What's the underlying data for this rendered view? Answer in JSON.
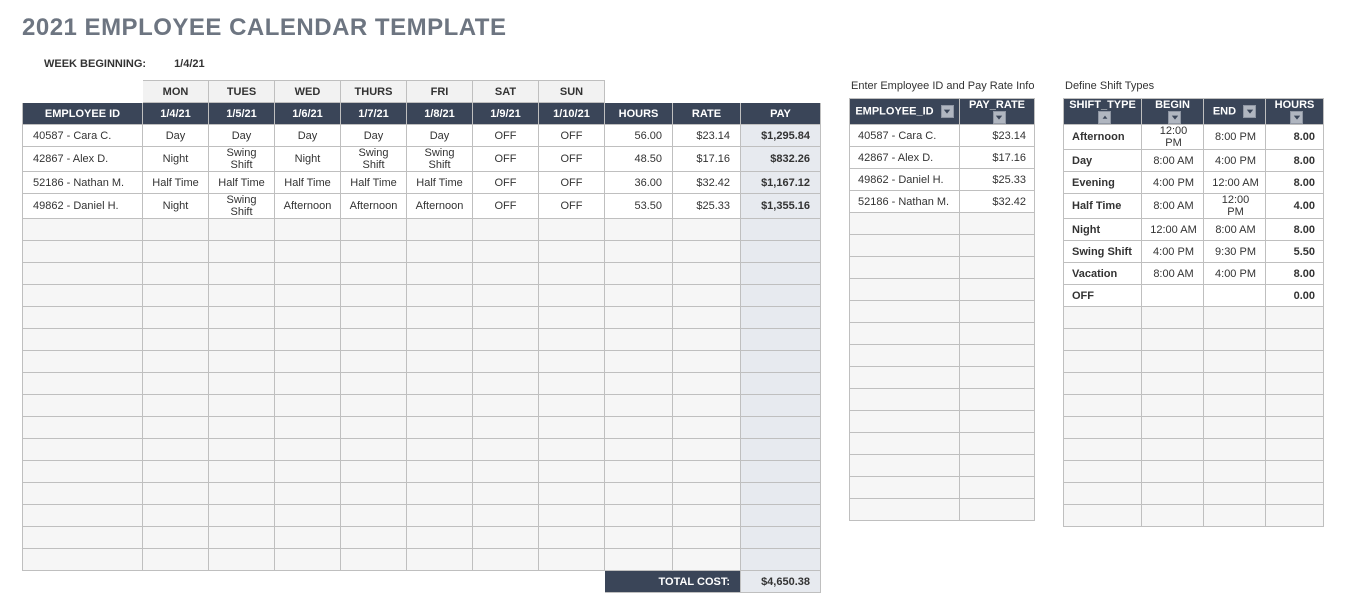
{
  "title": "2021 EMPLOYEE CALENDAR TEMPLATE",
  "week_beginning_label": "WEEK BEGINNING:",
  "week_beginning_value": "1/4/21",
  "schedule": {
    "days": [
      "MON",
      "TUES",
      "WED",
      "THURS",
      "FRI",
      "SAT",
      "SUN"
    ],
    "dates": [
      "1/4/21",
      "1/5/21",
      "1/6/21",
      "1/7/21",
      "1/8/21",
      "1/9/21",
      "1/10/21"
    ],
    "header_employee": "EMPLOYEE ID",
    "header_hours": "HOURS",
    "header_rate": "RATE",
    "header_pay": "PAY",
    "rows": [
      {
        "emp": "40587 - Cara C.",
        "cells": [
          "Day",
          "Day",
          "Day",
          "Day",
          "Day",
          "OFF",
          "OFF"
        ],
        "hours": "56.00",
        "rate": "$23.14",
        "pay": "$1,295.84"
      },
      {
        "emp": "42867 - Alex D.",
        "cells": [
          "Night",
          "Swing Shift",
          "Night",
          "Swing Shift",
          "Swing Shift",
          "OFF",
          "OFF"
        ],
        "hours": "48.50",
        "rate": "$17.16",
        "pay": "$832.26"
      },
      {
        "emp": "52186 - Nathan M.",
        "cells": [
          "Half Time",
          "Half Time",
          "Half Time",
          "Half Time",
          "Half Time",
          "OFF",
          "OFF"
        ],
        "hours": "36.00",
        "rate": "$32.42",
        "pay": "$1,167.12"
      },
      {
        "emp": "49862 - Daniel H.",
        "cells": [
          "Night",
          "Swing Shift",
          "Afternoon",
          "Afternoon",
          "Afternoon",
          "OFF",
          "OFF"
        ],
        "hours": "53.50",
        "rate": "$25.33",
        "pay": "$1,355.16"
      }
    ],
    "blank_rows": 16,
    "total_label": "TOTAL COST:",
    "total_value": "$4,650.38"
  },
  "emp_panel": {
    "label": "Enter Employee ID and Pay Rate Info",
    "header_id": "EMPLOYEE_ID",
    "header_rate": "PAY_RATE",
    "rows": [
      {
        "id": "40587 - Cara C.",
        "rate": "$23.14"
      },
      {
        "id": "42867 - Alex D.",
        "rate": "$17.16"
      },
      {
        "id": "49862 - Daniel H.",
        "rate": "$25.33"
      },
      {
        "id": "52186 - Nathan M.",
        "rate": "$32.42"
      }
    ],
    "blank_rows": 14
  },
  "shift_panel": {
    "label": "Define Shift Types",
    "header_type": "SHIFT_TYPE",
    "header_begin": "BEGIN",
    "header_end": "END",
    "header_hours": "HOURS",
    "rows": [
      {
        "type": "Afternoon",
        "begin": "12:00 PM",
        "end": "8:00 PM",
        "hours": "8.00"
      },
      {
        "type": "Day",
        "begin": "8:00 AM",
        "end": "4:00 PM",
        "hours": "8.00"
      },
      {
        "type": "Evening",
        "begin": "4:00 PM",
        "end": "12:00 AM",
        "hours": "8.00"
      },
      {
        "type": "Half Time",
        "begin": "8:00 AM",
        "end": "12:00 PM",
        "hours": "4.00"
      },
      {
        "type": "Night",
        "begin": "12:00 AM",
        "end": "8:00 AM",
        "hours": "8.00"
      },
      {
        "type": "Swing Shift",
        "begin": "4:00 PM",
        "end": "9:30 PM",
        "hours": "5.50"
      },
      {
        "type": "Vacation",
        "begin": "8:00 AM",
        "end": "4:00 PM",
        "hours": "8.00"
      },
      {
        "type": "OFF",
        "begin": "",
        "end": "",
        "hours": "0.00"
      }
    ],
    "blank_rows": 10
  }
}
